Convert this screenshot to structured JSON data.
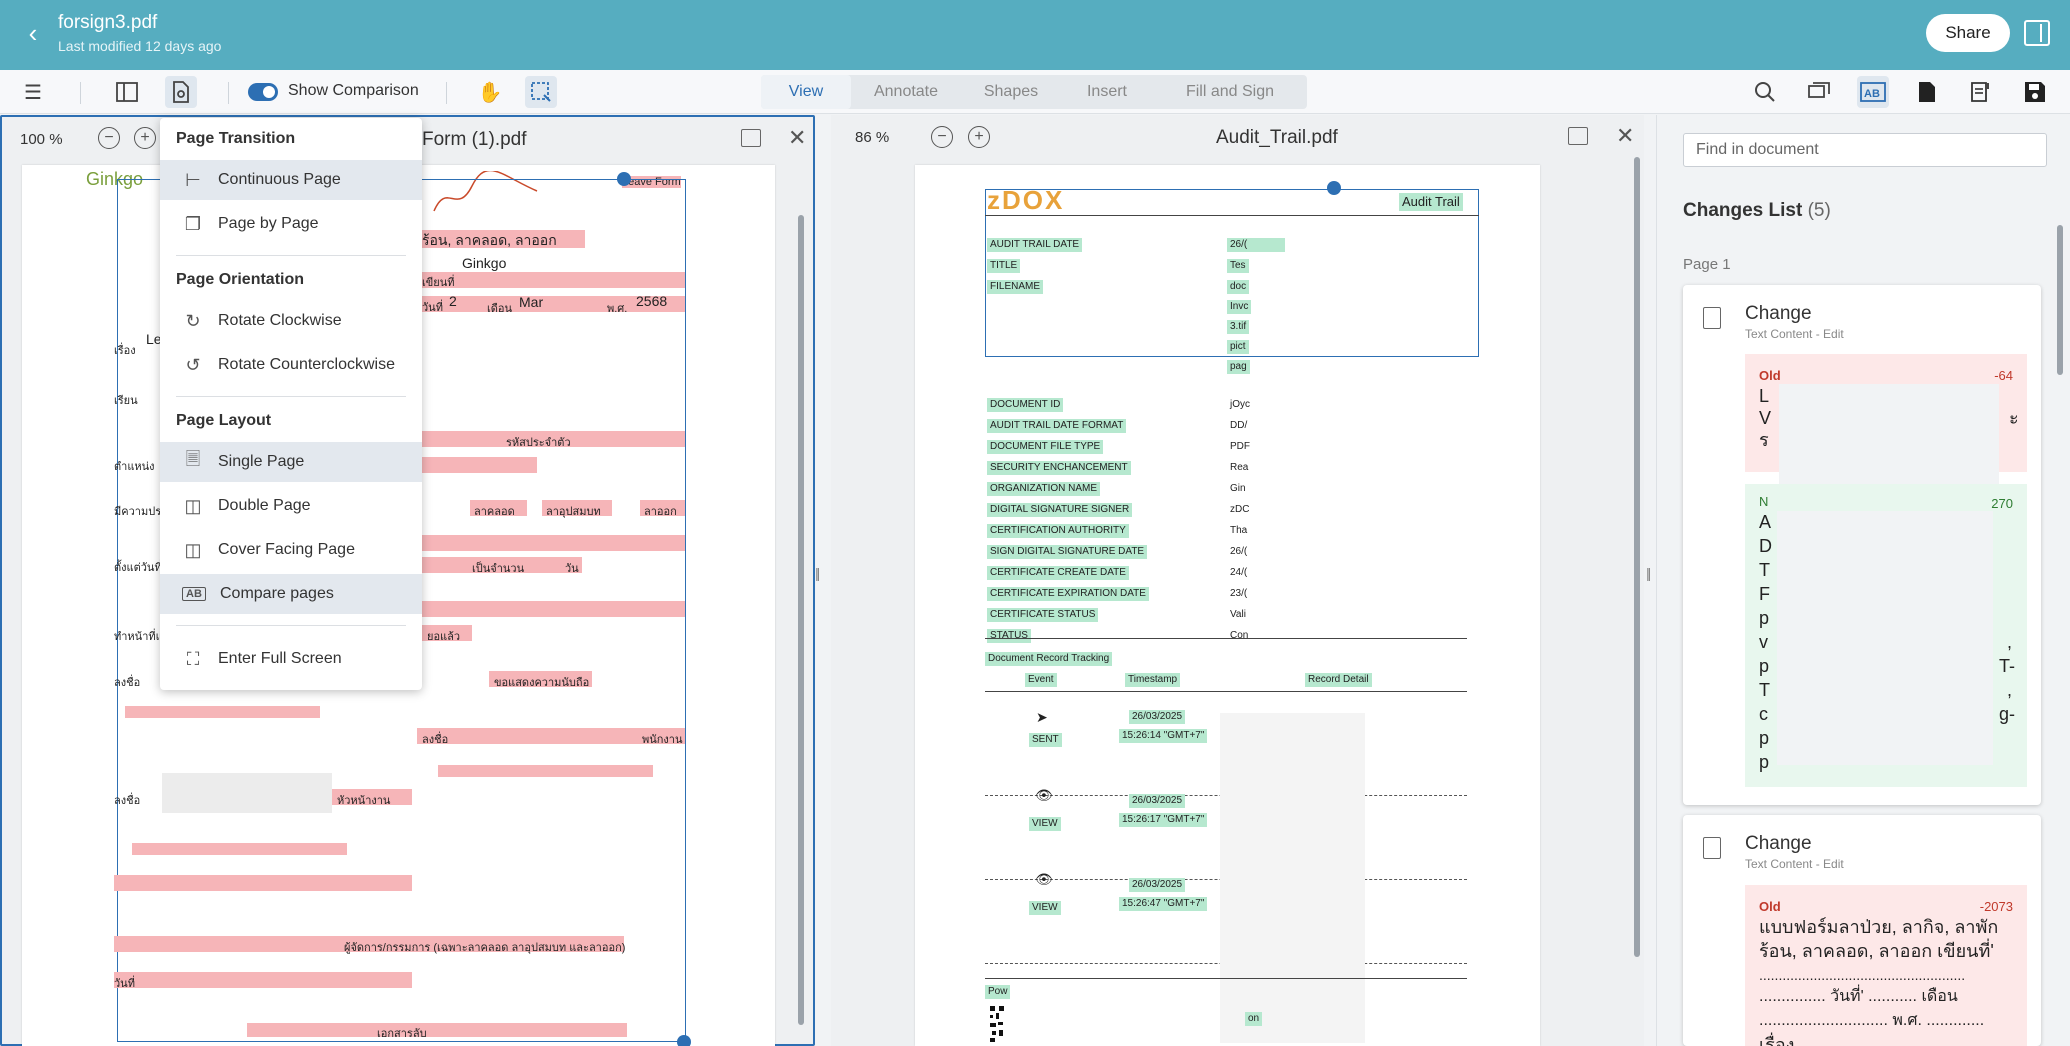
{
  "header": {
    "title": "forsign3.pdf",
    "subtitle": "Last modified 12 days ago",
    "share_label": "Share"
  },
  "toolbar": {
    "show_comparison_label": "Show Comparison",
    "tabs": [
      {
        "label": "View",
        "active": true
      },
      {
        "label": "Annotate",
        "active": false
      },
      {
        "label": "Shapes",
        "active": false
      },
      {
        "label": "Insert",
        "active": false
      },
      {
        "label": "Fill and Sign",
        "active": false
      }
    ]
  },
  "left_doc": {
    "zoom": "100 %",
    "title": "Form (1).pdf",
    "logo": "Ginkgo",
    "header_tag": "Leave Form",
    "line_title": "ร้อน, ลาคลอด, ลาออก",
    "line_company": "Ginkgo",
    "date_day": "2",
    "date_month": "Mar",
    "date_year": "2568",
    "label_write": "เขียนที่",
    "label_day": "วันที่",
    "label_month": "เดือน",
    "label_year": "พ.ศ.",
    "label_subject": "เรื่อง",
    "label_to": "เรียน",
    "label_position": "ตำแหน่ง",
    "label_intent": "มีความประ",
    "label_from": "ตั้งแต่วันที่",
    "label_total": "เป็นจำนวน",
    "label_days": "วัน",
    "label_staff_id": "รหัสประจำตัว",
    "label_maternity": "ลาคลอด",
    "label_ordain": "ลาอุปสมบท",
    "label_resign": "ลาออก",
    "label_handover": "ทำหน้าที่แท",
    "label_done": "ยอแล้ว",
    "label_sign": "ลงชื่อ",
    "label_respect": "ขอแสดงความนับถือ",
    "label_employee": "พนักงาน",
    "label_head": "หัวหน้างาน",
    "label_manager": "ผู้จัดการ/กรรมการ (เฉพาะลาคลอด ลาอุปสมบท และลาออก)",
    "label_confidential": "เอกสารลับ",
    "label_le": "Le"
  },
  "right_doc": {
    "zoom": "86 %",
    "title": "Audit_Trail.pdf",
    "badge": "Audit Trail",
    "logo": "zDOX",
    "fields_top": [
      "AUDIT TRAIL DATE",
      "TITLE",
      "FILENAME"
    ],
    "values_top": [
      "26/(",
      "Tes",
      "doc",
      "Invc",
      "3.tif",
      "pict",
      "pag"
    ],
    "fields": [
      "DOCUMENT ID",
      "AUDIT TRAIL DATE FORMAT",
      "DOCUMENT FILE TYPE",
      "SECURITY ENCHANCEMENT",
      "ORGANIZATION NAME",
      "DIGITAL SIGNATURE SIGNER",
      "CERTIFICATION AUTHORITY",
      "SIGN DIGITAL SIGNATURE DATE",
      "CERTIFICATE CREATE DATE",
      "CERTIFICATE EXPIRATION DATE",
      "CERTIFICATE STATUS",
      "STATUS"
    ],
    "values": [
      "jOyc",
      "DD/",
      "PDF",
      "Rea",
      "Gin",
      "zDC",
      "Tha",
      "26/(",
      "24/(",
      "23/(",
      "Vali",
      "Con"
    ],
    "tracking_title": "Document Record Tracking",
    "tracking_headers": [
      "Event",
      "Timestamp",
      "Record Detail"
    ],
    "events": [
      {
        "event": "SENT",
        "date": "26/03/2025",
        "time": "15:26:14 \"GMT+7\""
      },
      {
        "event": "VIEW",
        "date": "26/03/2025",
        "time": "15:26:17 \"GMT+7\""
      },
      {
        "event": "VIEW",
        "date": "26/03/2025",
        "time": "15:26:47 \"GMT+7\""
      }
    ],
    "footer_left": "Pow",
    "footer_right": "on"
  },
  "view_menu": {
    "sections": [
      {
        "heading": "Page Transition",
        "items": [
          {
            "label": "Continuous Page",
            "icon": "continuous-page-icon",
            "selected": true
          },
          {
            "label": "Page by Page",
            "icon": "page-by-page-icon",
            "selected": false
          }
        ]
      },
      {
        "heading": "Page Orientation",
        "items": [
          {
            "label": "Rotate Clockwise",
            "icon": "rotate-clockwise-icon",
            "selected": false
          },
          {
            "label": "Rotate Counterclockwise",
            "icon": "rotate-counterclockwise-icon",
            "selected": false
          }
        ]
      },
      {
        "heading": "Page Layout",
        "items": [
          {
            "label": "Single Page",
            "icon": "single-page-icon",
            "selected": true
          },
          {
            "label": "Double Page",
            "icon": "double-page-icon",
            "selected": false
          },
          {
            "label": "Cover Facing Page",
            "icon": "cover-facing-page-icon",
            "selected": false
          },
          {
            "label": "Compare pages",
            "icon": "compare-pages-icon",
            "selected": true
          }
        ]
      }
    ],
    "fullscreen_label": "Enter Full Screen"
  },
  "sidebar": {
    "find_placeholder": "Find in document",
    "changes_title": "Changes List",
    "changes_count": "(5)",
    "page_label": "Page 1",
    "cards": [
      {
        "title": "Change",
        "subtitle": "Text Content - Edit",
        "old_label": "Old",
        "old_num": "-64",
        "old_lines": [
          "L",
          "V",
          "ร"
        ],
        "old_tail": "ะ",
        "new_label": "N",
        "new_num": "270",
        "new_lines": [
          "A",
          "D",
          "T",
          "F",
          "p",
          "v",
          "p",
          "T",
          "c",
          "p",
          "p"
        ],
        "new_tails": [
          ",",
          "T-",
          ",",
          "g-"
        ]
      },
      {
        "title": "Change",
        "subtitle": "Text Content - Edit",
        "old_label": "Old",
        "old_num": "-2073",
        "old_lines": [
          "แบบฟอร์มลาป่วย, ลากิจ, ลาพัก",
          "ร้อน, ลาคลอด, ลาออก เขียนที่'",
          ".....................................................",
          "............... วันที่' ........... เดือน",
          "............................. พ.ศ. .............",
          "เรื่อง"
        ]
      }
    ]
  },
  "colors": {
    "header_bg": "#56adc0",
    "accent": "#2d6fb3",
    "old_bg": "#fde8e8",
    "new_bg": "#e8f7ee",
    "highlight_old": "#f6b5b8",
    "highlight_new": "#b6e8cf"
  }
}
